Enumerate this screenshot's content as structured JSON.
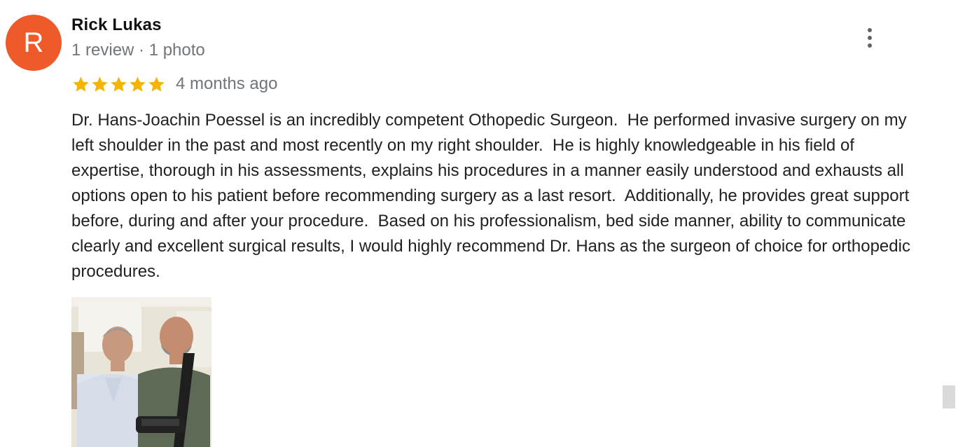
{
  "reviewer": {
    "avatar_letter": "R",
    "avatar_color": "#ef5a2b",
    "name": "Rick Lukas",
    "meta": "1 review · 1 photo"
  },
  "review": {
    "rating": 5,
    "rating_max": 5,
    "star_color": "#f4b400",
    "time_ago": "4 months ago",
    "text": "Dr. Hans-Joachin Poessel is an incredibly competent Othopedic Surgeon.  He performed invasive surgery on my left shoulder in the past and most recently on my right shoulder.  He is highly knowledgeable in his field of expertise, thorough in his assessments, explains his procedures in a manner easily understood and exhausts all options open to his patient before recommending surgery as a last resort.  Additionally, he provides great support before, during and after your procedure.  Based on his professionalism, bed side manner, ability to communicate clearly and excellent surgical results, I would highly recommend Dr. Hans as the surgeon of choice for orthopedic procedures."
  },
  "icons": {
    "more": "more-vert-icon",
    "star": "star-icon"
  }
}
